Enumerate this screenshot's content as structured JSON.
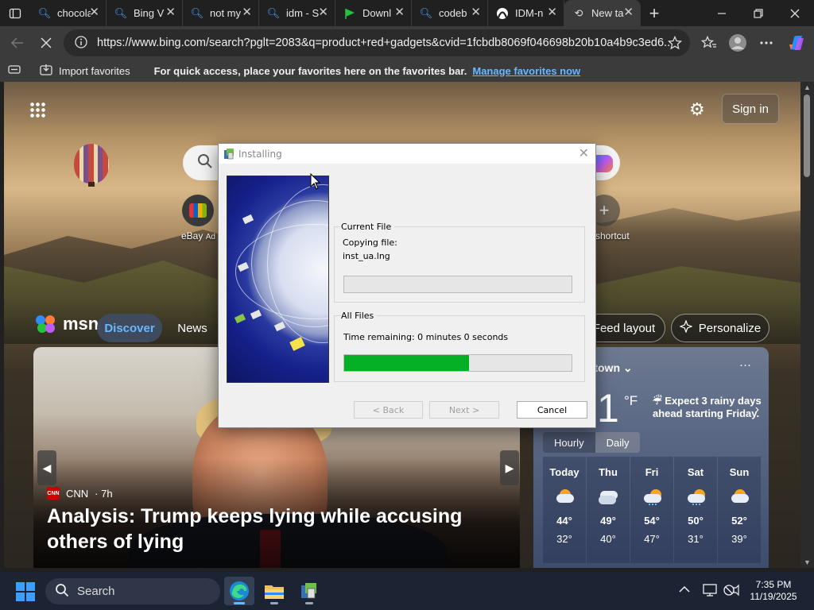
{
  "browser": {
    "tabs": [
      {
        "title": "chocolate",
        "icon": "bing-search-icon"
      },
      {
        "title": "Bing V",
        "icon": "bing-search-icon"
      },
      {
        "title": "not my",
        "icon": "bing-search-icon"
      },
      {
        "title": "idm - S",
        "icon": "bing-search-icon"
      },
      {
        "title": "Downl",
        "icon": "green-flag-icon"
      },
      {
        "title": "codeb",
        "icon": "bing-search-icon"
      },
      {
        "title": "IDM-n",
        "icon": "site-logo-icon"
      },
      {
        "title": "New ta",
        "icon": "loading-icon",
        "active": true
      }
    ],
    "url": "https://www.bing.com/search?pglt=2083&q=product+red+gadgets&cvid=1fcbdb8069f046698b20b10a4b9c3ed6...",
    "favorites_bar": {
      "import_label": "Import favorites",
      "message": "For quick access, place your favorites here on the favorites bar.",
      "link": "Manage favorites now"
    }
  },
  "newtab": {
    "signin": "Sign in",
    "shortcuts": [
      {
        "label": "eBay",
        "badge": "Ad"
      },
      {
        "label": "shortcut"
      }
    ],
    "msn": {
      "logo": "msn",
      "tabs": [
        "Discover",
        "News"
      ],
      "feed_layout": "Feed layout",
      "personalize": "Personalize"
    },
    "news": {
      "source": "CNN",
      "age": "· 7h",
      "headline": "Analysis: Trump keeps lying while accusing others of lying"
    },
    "weather": {
      "location": "nstown",
      "temp": "1",
      "unit": "°F",
      "forecast": "Expect 3 rainy days ahead starting Friday.",
      "toggle": [
        "Hourly",
        "Daily"
      ],
      "selected_toggle": "Daily",
      "days": [
        {
          "name": "Today",
          "hi": "44°",
          "lo": "32°",
          "icon": "partly-sunny"
        },
        {
          "name": "Thu",
          "hi": "49°",
          "lo": "40°",
          "icon": "cloudy"
        },
        {
          "name": "Fri",
          "hi": "54°",
          "lo": "47°",
          "icon": "rain"
        },
        {
          "name": "Sat",
          "hi": "50°",
          "lo": "31°",
          "icon": "rain"
        },
        {
          "name": "Sun",
          "hi": "52°",
          "lo": "39°",
          "icon": "partly-sunny"
        }
      ]
    }
  },
  "installer": {
    "title": "Installing",
    "current_file_label": "Current File",
    "copying_label": "Copying file:",
    "file_name": "inst_ua.lng",
    "current_progress": 0,
    "all_files_label": "All Files",
    "time_remaining": "Time remaining: 0 minutes 0 seconds",
    "all_progress": 0.55,
    "buttons": {
      "back": "< Back",
      "next": "Next >",
      "cancel": "Cancel"
    }
  },
  "taskbar": {
    "search": "Search",
    "time": "7:35 PM",
    "date": "11/19/2025"
  },
  "colors": {
    "accent": "#3aa0ff",
    "progress": "#06b025",
    "msn_discover": "#6ab8ff"
  }
}
